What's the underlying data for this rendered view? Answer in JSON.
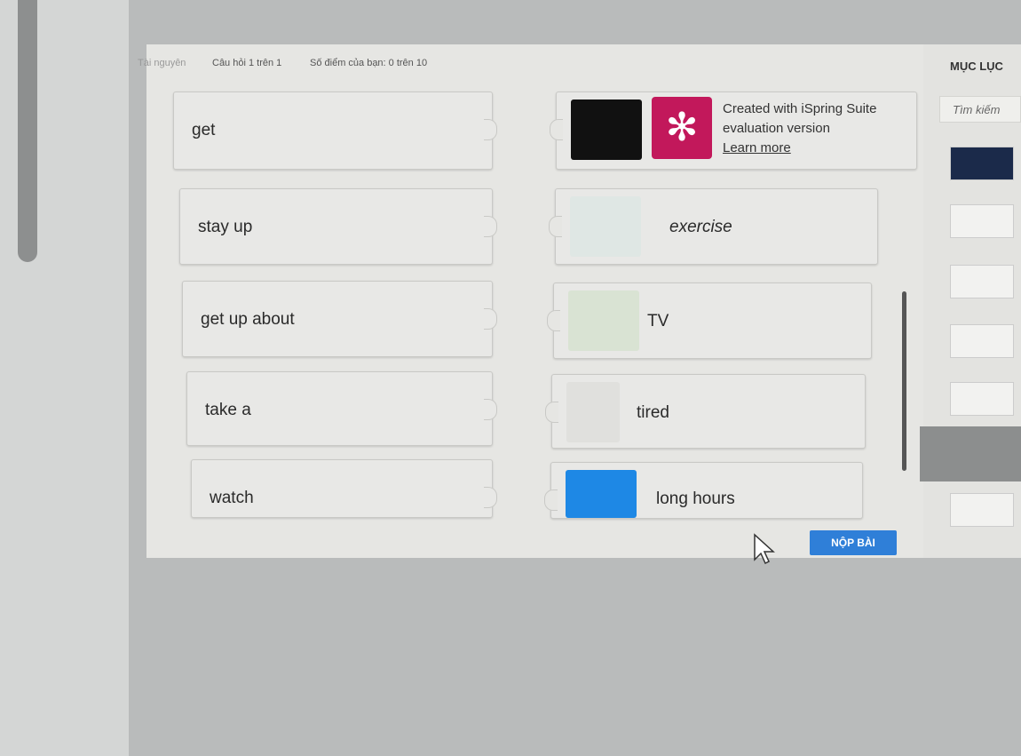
{
  "topbar": {
    "resources": "Tài nguyên",
    "question": "Câu hỏi 1 trên 1",
    "score": "Số điểm của bạn: 0 trên 10"
  },
  "sidebar": {
    "title": "MỤC LỤC",
    "search_placeholder": "Tìm kiếm"
  },
  "banner": {
    "line1": "Created with iSpring Suite",
    "line2": "evaluation version",
    "link": "Learn more",
    "logo_icon": "ispring-logo-icon",
    "color": "#c2185b"
  },
  "left_items": [
    "get",
    "stay up",
    "get up about",
    "take a",
    "watch"
  ],
  "right_items": [
    "",
    "exercise",
    "TV",
    "tired",
    "long hours"
  ],
  "submit": "NỘP BÀI",
  "accent": "#2f7fd8"
}
